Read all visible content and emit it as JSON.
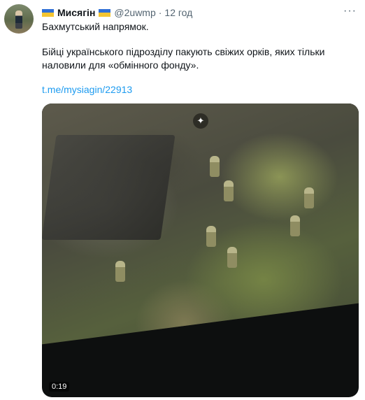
{
  "tweet": {
    "author_name": "Мисягін",
    "handle": "@2uwmp",
    "separator": "·",
    "time": "12 год",
    "more_label": "···",
    "text_line1": "Бахмутський напрямок.",
    "text_line2": "Бійці українського підрозділу пакують свіжих орків, яких тільки",
    "text_line3": "наловили для «обмінного фонду».",
    "link": "t.me/mysiagin/22913",
    "flag_colors": {
      "blue": "#2f6fd6",
      "yellow": "#f4c531"
    }
  },
  "media": {
    "type": "video",
    "duration": "0:19",
    "sparkle_icon": "sparkle-icon"
  }
}
